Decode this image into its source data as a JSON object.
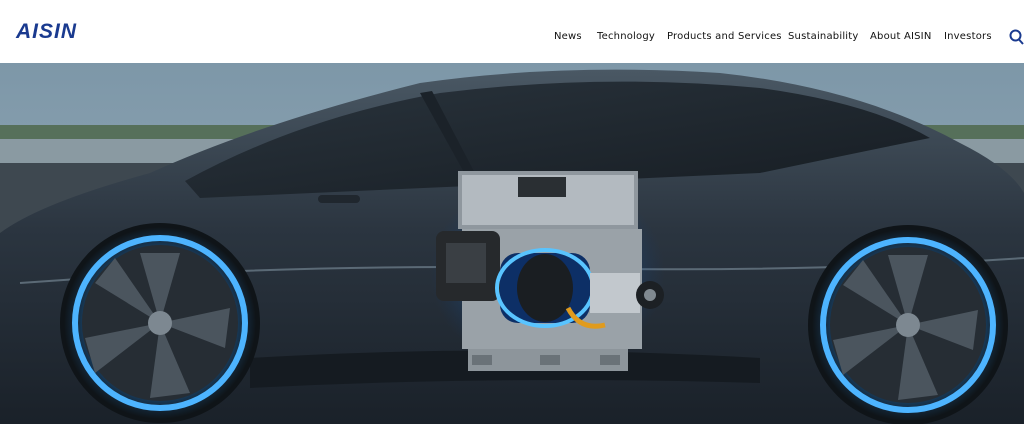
{
  "brand": {
    "logo_text": "AISIN",
    "logo_color": "#1a3a8f"
  },
  "nav": {
    "items": [
      {
        "label": "News"
      },
      {
        "label": "Technology"
      },
      {
        "label": "Products and Services"
      },
      {
        "label": "Sustainability"
      },
      {
        "label": "About AISIN"
      },
      {
        "label": "Investors"
      }
    ],
    "search_icon": "search-icon"
  },
  "hero": {
    "image": "electric-car-with-eaxle-unit",
    "accent_color": "#2f9bff"
  }
}
